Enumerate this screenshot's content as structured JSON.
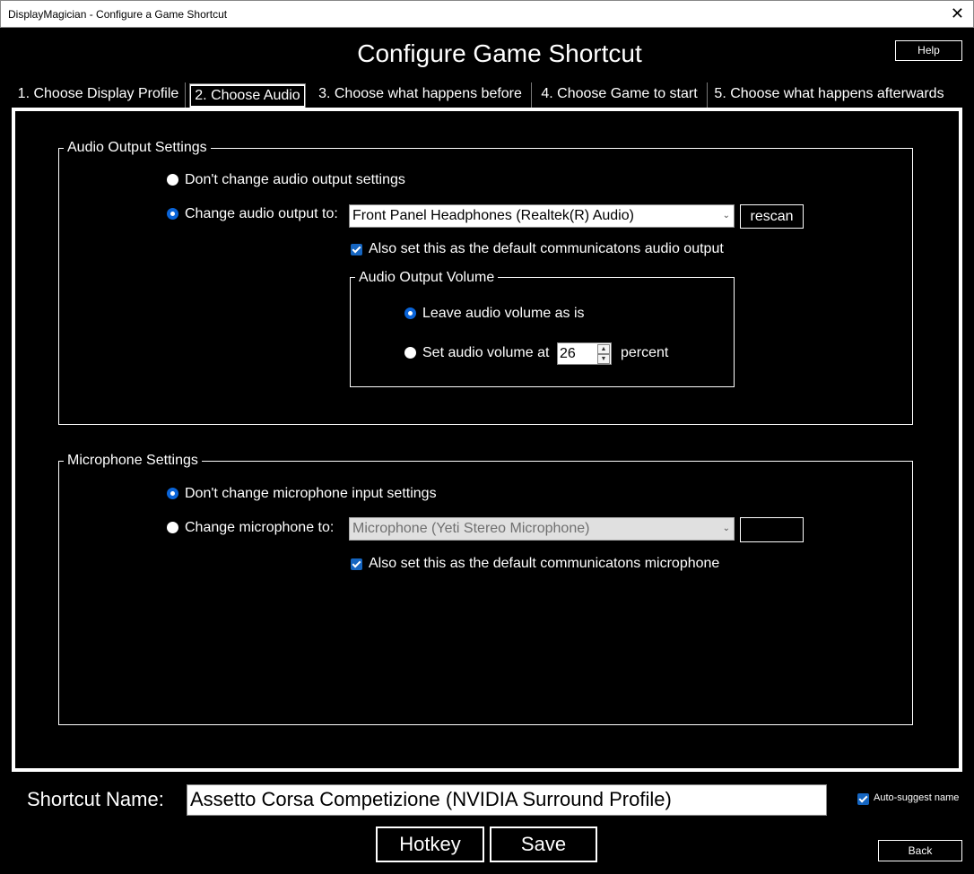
{
  "window": {
    "title": "DisplayMagician - Configure a Game Shortcut",
    "close_glyph": "✕"
  },
  "header": {
    "title": "Configure Game Shortcut",
    "help_label": "Help"
  },
  "tabs": [
    {
      "label": "1. Choose Display Profile"
    },
    {
      "label": "2. Choose Audio"
    },
    {
      "label": "3. Choose what happens before"
    },
    {
      "label": "4. Choose Game to start"
    },
    {
      "label": "5. Choose what happens afterwards"
    }
  ],
  "active_tab": 1,
  "audio_output": {
    "group_title": "Audio Output Settings",
    "dont_change_label": "Don't change audio output settings",
    "change_label": "Change audio output to:",
    "selected_device": "Front Panel Headphones (Realtek(R) Audio)",
    "rescan_label": "rescan",
    "default_comms_label": "Also set this as the default communicatons audio output",
    "default_comms_checked": true,
    "selected_option": "change",
    "volume": {
      "group_title": "Audio Output Volume",
      "leave_label": "Leave audio volume as is",
      "set_label": "Set audio volume at",
      "value": "26",
      "unit_label": "percent",
      "selected_option": "leave"
    }
  },
  "microphone": {
    "group_title": "Microphone Settings",
    "dont_change_label": "Don't change microphone input settings",
    "change_label": "Change microphone to:",
    "selected_device": "Microphone (Yeti Stereo Microphone)",
    "default_comms_label": "Also set this as the default communicatons microphone",
    "default_comms_checked": true,
    "selected_option": "dont_change"
  },
  "footer": {
    "shortcut_name_label": "Shortcut Name:",
    "shortcut_name_value": "Assetto Corsa Competizione (NVIDIA Surround Profile)",
    "auto_suggest_label": "Auto-suggest name",
    "auto_suggest_checked": true,
    "hotkey_label": "Hotkey",
    "save_label": "Save",
    "back_label": "Back"
  },
  "icons": {
    "dropdown": "chevron-down-icon",
    "spin_up": "spin-up-icon",
    "spin_down": "spin-down-icon"
  }
}
